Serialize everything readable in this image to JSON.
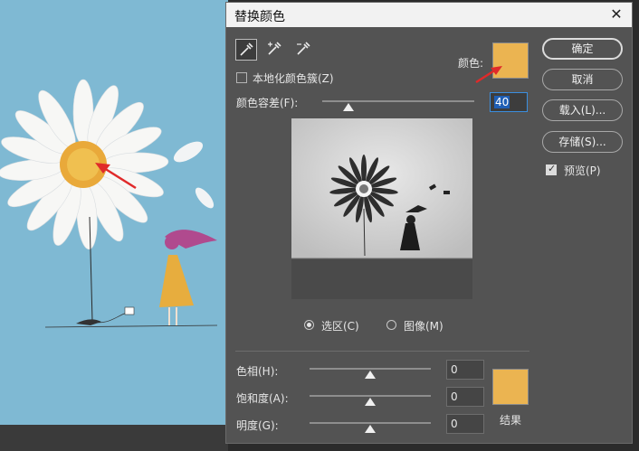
{
  "dialog": {
    "title": "替换颜色",
    "close_glyph": "✕",
    "tools": [
      "eyedropper-icon",
      "eyedropper-plus-icon",
      "eyedropper-minus-icon"
    ],
    "localized_clusters_label": "本地化颜色簇(Z)",
    "color_label": "颜色:",
    "selected_color": "#ebb451",
    "fuzziness_label": "颜色容差(F):",
    "fuzziness_value": "40",
    "fuzziness_fraction": 0.17,
    "view_selection_label": "选区(C)",
    "view_image_label": "图像(M)",
    "hue_label": "色相(H):",
    "hue_value": "0",
    "saturation_label": "饱和度(A):",
    "saturation_value": "0",
    "lightness_label": "明度(G):",
    "lightness_value": "0",
    "result_label": "结果",
    "result_color": "#ebb451"
  },
  "buttons": {
    "ok": "确定",
    "cancel": "取消",
    "load": "载入(L)...",
    "save": "存储(S)...",
    "preview": "预览(P)"
  },
  "colors": {
    "annotation_arrow": "#e02a2a",
    "canvas_background": "#7fb9d3"
  }
}
